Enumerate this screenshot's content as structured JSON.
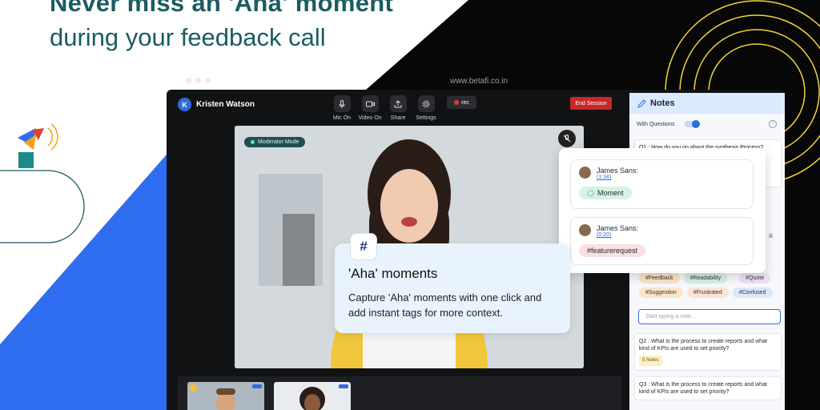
{
  "headline": "Never miss an 'Aha' moment",
  "subline": "during your feedback call",
  "browser": {
    "url": "www.betafi.co.in"
  },
  "call": {
    "user_initial": "K",
    "user_name": "Kristen Watson",
    "controls": [
      {
        "label": "Mic On",
        "icon": "mic-icon"
      },
      {
        "label": "Video On",
        "icon": "video-icon"
      },
      {
        "label": "Share",
        "icon": "share-icon"
      },
      {
        "label": "Settings",
        "icon": "gear-icon"
      }
    ],
    "rec_label": "rec",
    "end_label": "End Session",
    "moderator_label": "Moderator Mode"
  },
  "notes": {
    "title": "Notes",
    "with_questions": "With Questions",
    "q1": "Q1 : How do you go about the synthesis Process?",
    "q2": "Q2 : What is the process to create reports and what kind of KPIs are used to set priority?",
    "q2_badge": "5 Notes",
    "q3": "Q3 : What is the process to create reports and what kind of KPIs are used to set priority?",
    "tags": [
      "#Feedback",
      "#Readability",
      "#Quote",
      "#Suggestion",
      "#Frustrated",
      "#Confused"
    ],
    "placeholder": "Start typing a note...",
    "partial_text": "ill"
  },
  "overlay": {
    "entries": [
      {
        "name": "James Sans:",
        "time": "(1:34)",
        "tag": "Moment"
      },
      {
        "name": "James Sans:",
        "time": "(0:20)",
        "tag": "#featurerequest"
      }
    ]
  },
  "tooltip": {
    "symbol": "#",
    "title": "'Aha' moments",
    "body": "Capture 'Aha' moments with one click and add instant tags for more context."
  },
  "colors": {
    "brand_teal": "#1b5b62",
    "accent_blue": "#2d6cdf",
    "end_red": "#c62828",
    "tooltip_bg": "#e8f3fd"
  }
}
